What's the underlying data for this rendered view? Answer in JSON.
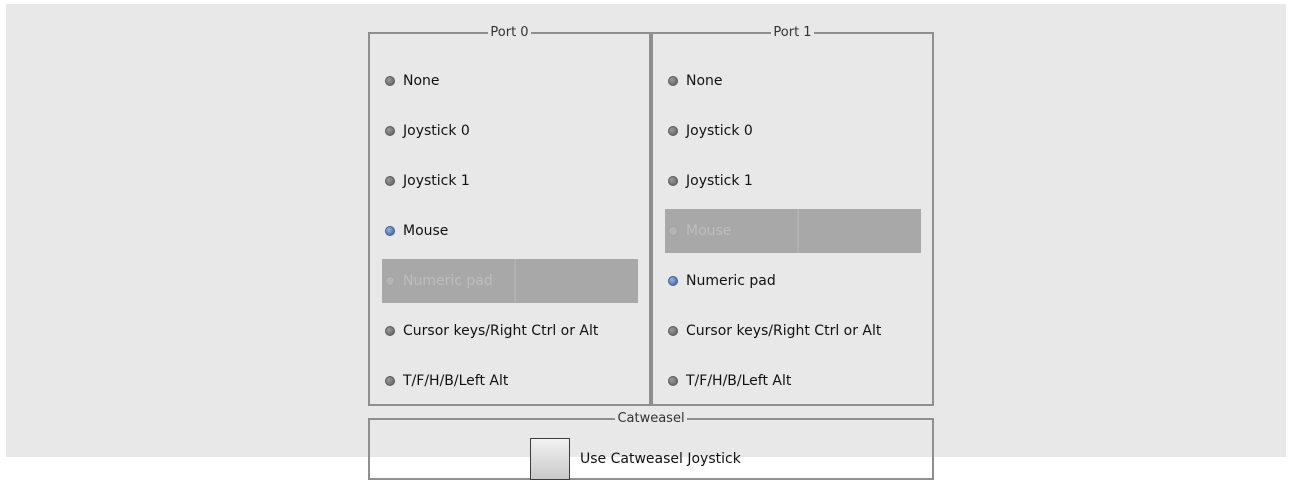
{
  "port0": {
    "title": "Port 0",
    "options": [
      {
        "label": "None",
        "state": "normal"
      },
      {
        "label": "Joystick 0",
        "state": "normal"
      },
      {
        "label": "Joystick 1",
        "state": "normal"
      },
      {
        "label": "Mouse",
        "state": "selected"
      },
      {
        "label": "Numeric pad",
        "state": "disabled"
      },
      {
        "label": "Cursor keys/Right Ctrl or Alt",
        "state": "normal"
      },
      {
        "label": "T/F/H/B/Left Alt",
        "state": "normal"
      }
    ]
  },
  "port1": {
    "title": "Port 1",
    "options": [
      {
        "label": "None",
        "state": "normal"
      },
      {
        "label": "Joystick 0",
        "state": "normal"
      },
      {
        "label": "Joystick 1",
        "state": "normal"
      },
      {
        "label": "Mouse",
        "state": "disabled"
      },
      {
        "label": "Numeric pad",
        "state": "selected"
      },
      {
        "label": "Cursor keys/Right Ctrl or Alt",
        "state": "normal"
      },
      {
        "label": "T/F/H/B/Left Alt",
        "state": "normal"
      }
    ]
  },
  "catweasel": {
    "title": "Catweasel",
    "checkbox_label": "Use Catweasel Joystick",
    "checked": false
  },
  "colors": {
    "background": "#e8e8e8",
    "frame_border": "#8f8f8f",
    "selected_radio": "#4f74b5",
    "disabled_row": "#a8a8a8"
  }
}
